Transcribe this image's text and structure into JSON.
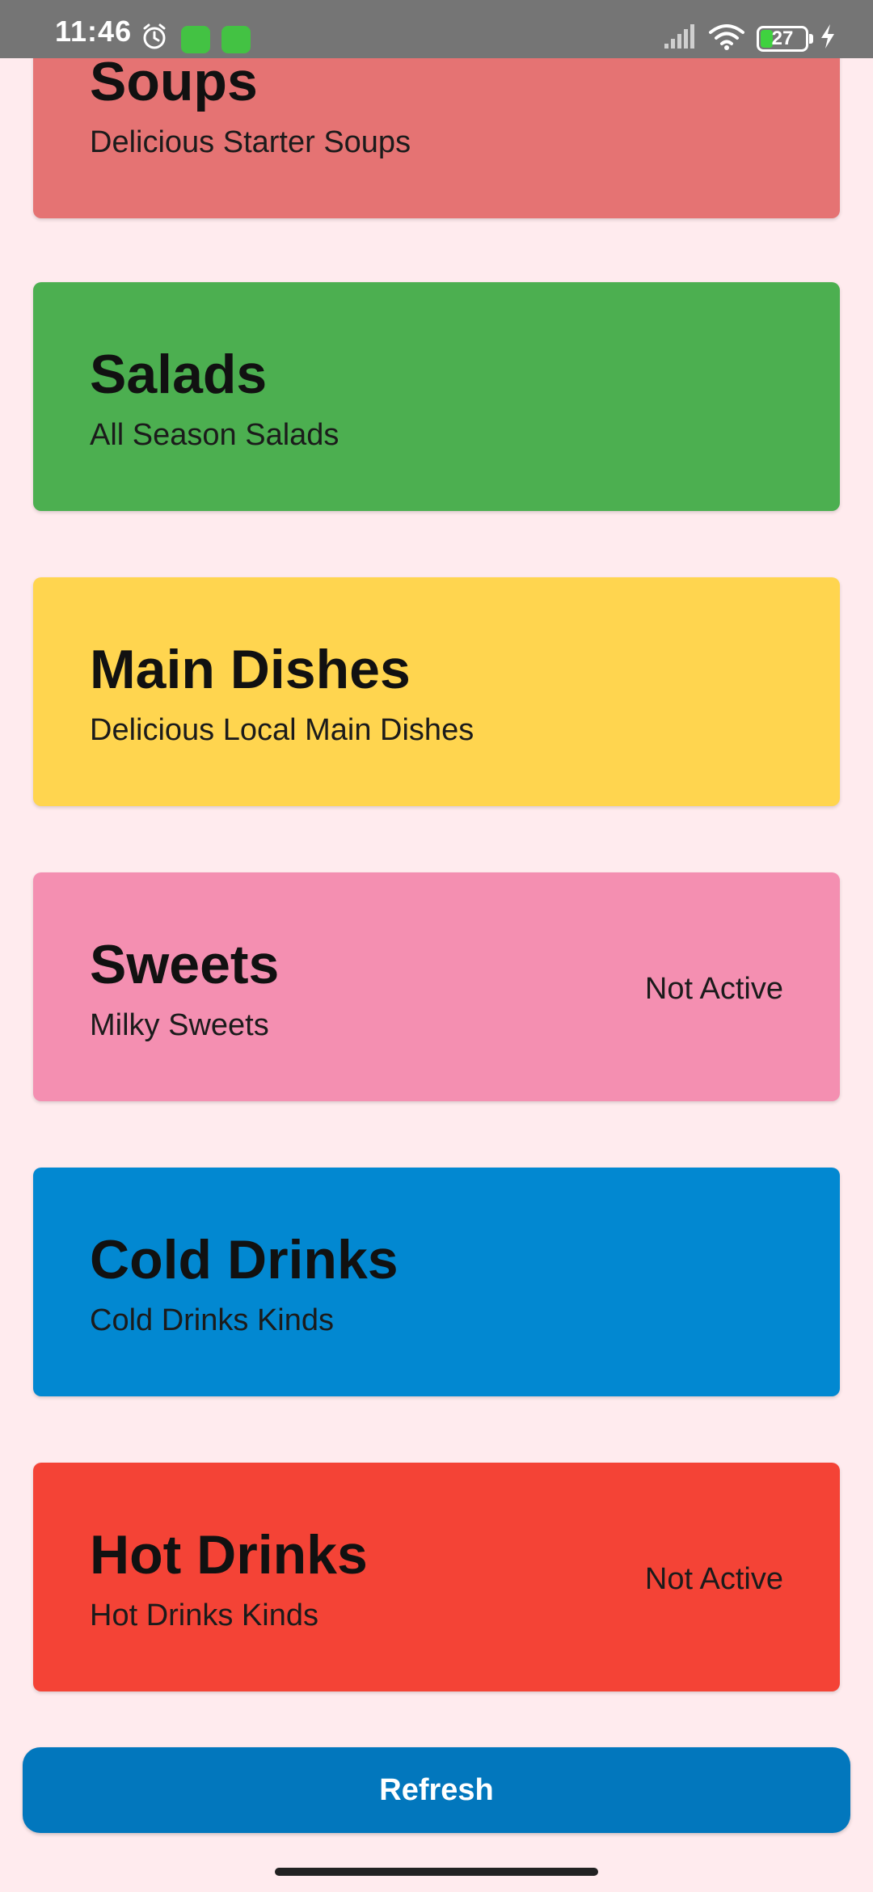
{
  "status_bar": {
    "time": "11:46",
    "battery_level": "27",
    "icons": [
      "alarm-icon",
      "app-notification-icon",
      "app-notification-icon",
      "signal-icon",
      "wifi-icon",
      "battery-icon",
      "charging-icon"
    ]
  },
  "categories": [
    {
      "title": "Soups",
      "subtitle": "Delicious Starter Soups",
      "status": "",
      "color": "#e57373"
    },
    {
      "title": "Salads",
      "subtitle": "All Season Salads",
      "status": "",
      "color": "#4caf50"
    },
    {
      "title": "Main Dishes",
      "subtitle": "Delicious Local Main Dishes",
      "status": "",
      "color": "#ffd54f"
    },
    {
      "title": "Sweets",
      "subtitle": "Milky Sweets",
      "status": "Not Active",
      "color": "#f48fb1"
    },
    {
      "title": "Cold Drinks",
      "subtitle": "Cold Drinks Kinds",
      "status": "",
      "color": "#0288d1"
    },
    {
      "title": "Hot Drinks",
      "subtitle": "Hot Drinks Kinds",
      "status": "Not Active",
      "color": "#f44336"
    }
  ],
  "refresh_label": "Refresh",
  "colors": {
    "background": "#ffebee",
    "status_bar": "#757575",
    "refresh_button": "#0277bd"
  }
}
